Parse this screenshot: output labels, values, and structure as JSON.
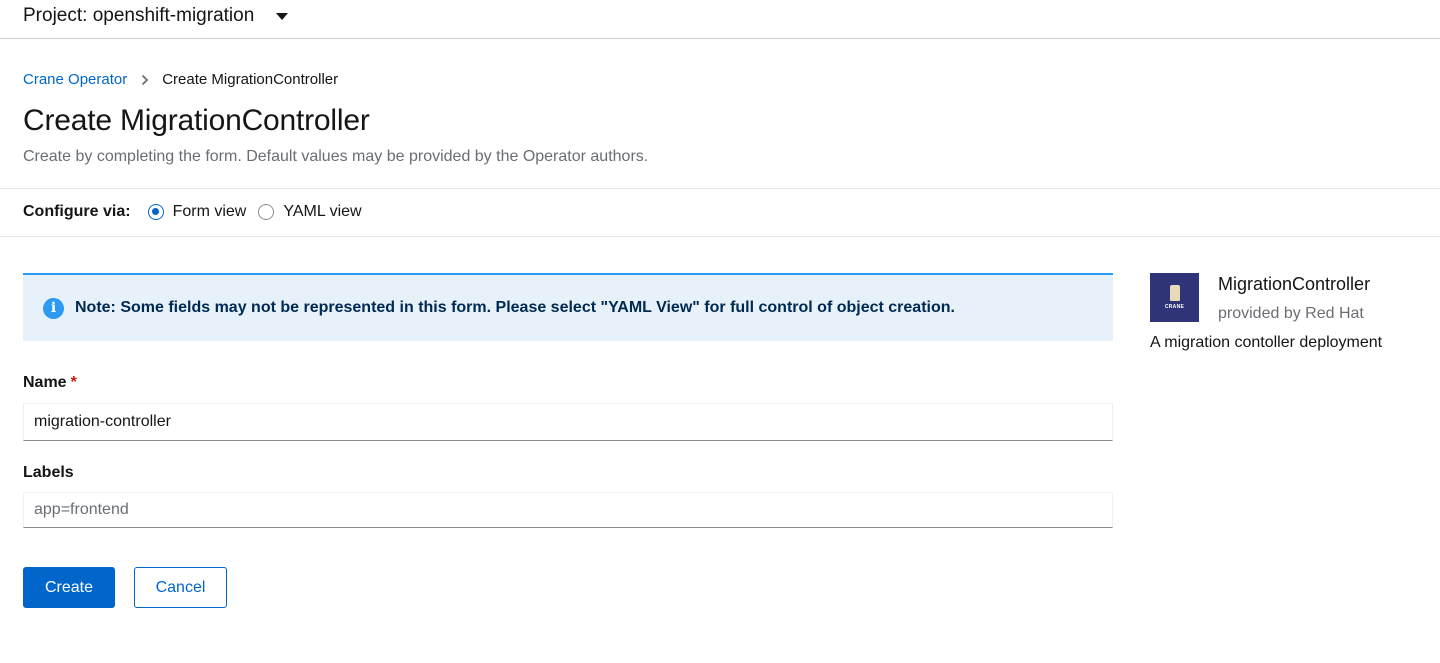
{
  "project": {
    "label": "Project: openshift-migration"
  },
  "breadcrumb": {
    "parent": "Crane Operator",
    "current": "Create MigrationController"
  },
  "page": {
    "title": "Create MigrationController",
    "subtitle": "Create by completing the form. Default values may be provided by the Operator authors."
  },
  "configure": {
    "label": "Configure via:",
    "options": [
      {
        "label": "Form view",
        "selected": true
      },
      {
        "label": "YAML view",
        "selected": false
      }
    ]
  },
  "alert": {
    "icon": "info-circle-icon",
    "message": "Note: Some fields may not be represented in this form. Please select \"YAML View\" for full control of object creation."
  },
  "form": {
    "name": {
      "label": "Name",
      "required_marker": "*",
      "value": "migration-controller"
    },
    "labels": {
      "label": "Labels",
      "value": "",
      "placeholder": "app=frontend"
    }
  },
  "actions": {
    "create": "Create",
    "cancel": "Cancel"
  },
  "side_panel": {
    "logo_text": "CRANE",
    "name": "MigrationController",
    "provider": "provided by Red Hat",
    "description": "A migration contoller deployment"
  },
  "colors": {
    "accent": "#0066cc",
    "alert_bg": "#e7f1fa",
    "alert_border": "#2b9af3",
    "required": "#c9190b",
    "logo_bg": "#2f3377"
  }
}
